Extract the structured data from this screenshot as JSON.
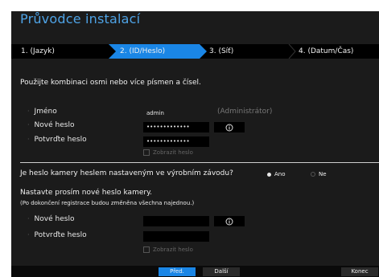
{
  "title": "Průvodce instalací",
  "steps": [
    {
      "label": "1.  (Jazyk)",
      "active": false
    },
    {
      "label": "2.  (ID/Heslo)",
      "active": true
    },
    {
      "label": "3.  (Síť)",
      "active": false
    },
    {
      "label": "4.  (Datum/Čas)",
      "active": false
    }
  ],
  "instruction": "Použijte kombinaci osmi nebo více písmen a čísel.",
  "account": {
    "name_label": "Jméno",
    "name_value": "admin",
    "name_hint": "(Administrátor)",
    "new_password_label": "Nové heslo",
    "new_password_value": "•••••••••••••",
    "confirm_password_label": "Potvrďte heslo",
    "confirm_password_value": "•••••••••••••",
    "show_password_label": "Zobrazit heslo"
  },
  "camera": {
    "question": "Je heslo kamery heslem nastaveným ve výrobním závodu?",
    "yes_label": "Ano",
    "no_label": "Ne",
    "selected": "Ano",
    "note_line1": "Nastavte prosím nové heslo kamery.",
    "note_line2": "(Po dokončení registrace budou změněna všechna najednou.)",
    "new_password_label": "Nové heslo",
    "new_password_value": "",
    "confirm_password_label": "Potvrďte heslo",
    "confirm_password_value": "",
    "show_password_label": "Zobrazit heslo"
  },
  "footer": {
    "prev_label": "Před.",
    "next_label": "Další",
    "finish_label": "Konec"
  },
  "colors": {
    "accent": "#1a86e6",
    "title": "#4ea3e6",
    "background": "#1b1b1b"
  }
}
